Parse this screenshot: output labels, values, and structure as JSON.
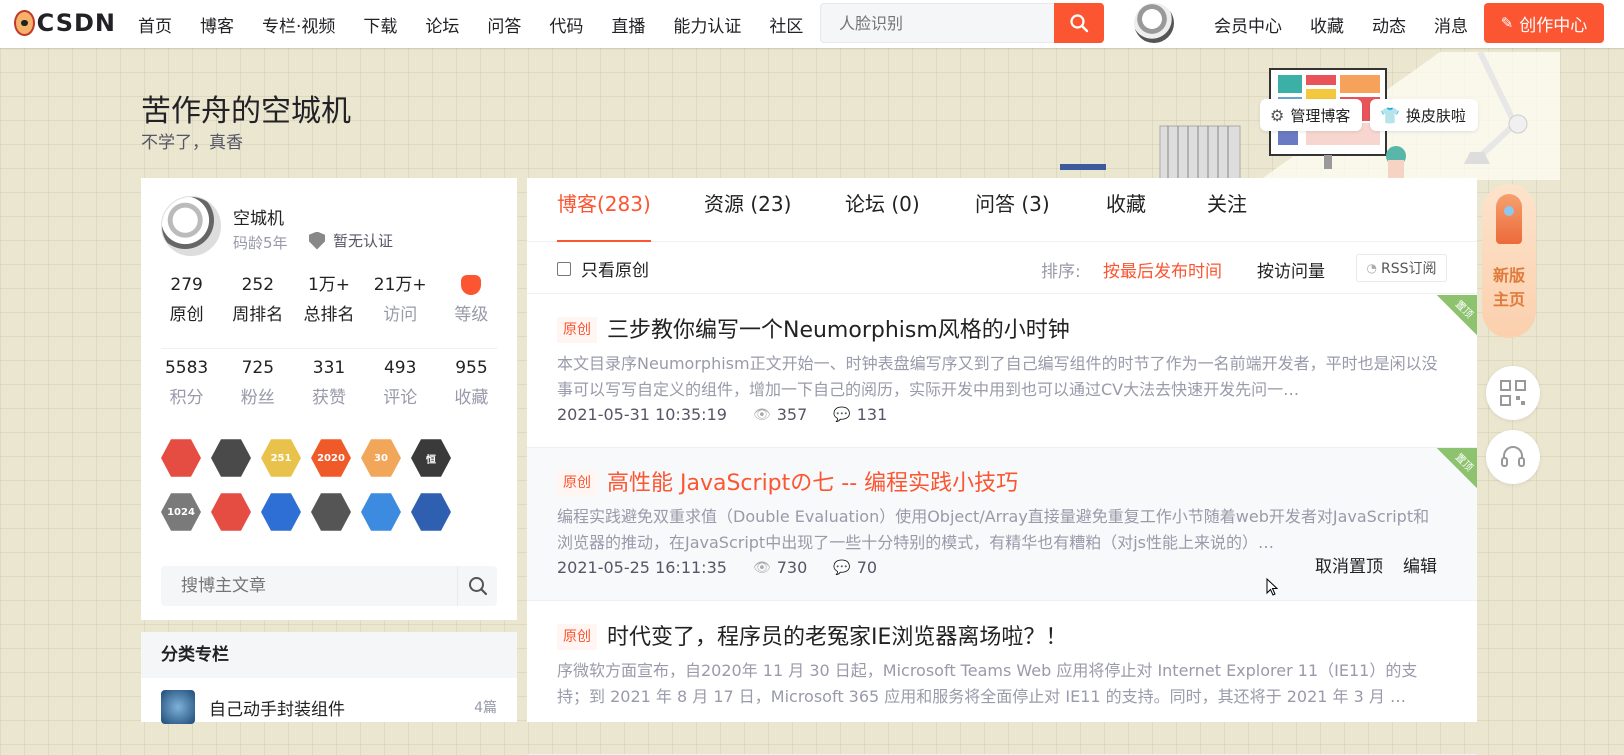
{
  "topbar": {
    "logo_text": "CSDN",
    "nav": [
      "首页",
      "博客",
      "专栏·视频",
      "下载",
      "论坛",
      "问答",
      "代码",
      "直播",
      "能力认证",
      "社区"
    ],
    "search_placeholder": "人脸识别",
    "right_links": [
      "会员中心",
      "收藏",
      "动态",
      "消息"
    ],
    "create_label": "创作中心"
  },
  "header": {
    "title": "苦作舟的空城机",
    "subtitle": "不学了，真香",
    "manage_label": "管理博客",
    "skin_label": "换皮肤啦"
  },
  "profile": {
    "name": "空城机",
    "age": "码龄5年",
    "cert": "暂无认证",
    "stats_row1": [
      {
        "value": "279",
        "label": "原创"
      },
      {
        "value": "252",
        "label": "周排名"
      },
      {
        "value": "1万+",
        "label": "总排名"
      },
      {
        "value": "21万+",
        "label": "访问"
      },
      {
        "value": "",
        "label": "等级"
      }
    ],
    "stats_row2": [
      {
        "value": "5583",
        "label": "积分"
      },
      {
        "value": "725",
        "label": "粉丝"
      },
      {
        "value": "331",
        "label": "获赞"
      },
      {
        "value": "493",
        "label": "评论"
      },
      {
        "value": "955",
        "label": "收藏"
      }
    ],
    "badges": [
      {
        "icon": "monkey-badge-icon",
        "color": "#e54d42",
        "text": ""
      },
      {
        "icon": "github-badge-icon",
        "color": "#4a4a4a",
        "text": ""
      },
      {
        "icon": "251-badge-icon",
        "color": "#e8c24a",
        "text": "251"
      },
      {
        "icon": "2020-badge-icon",
        "color": "#f05a28",
        "text": "2020"
      },
      {
        "icon": "30-badge-icon",
        "color": "#f2a65a",
        "text": "30"
      },
      {
        "icon": "heng-badge-icon",
        "color": "#3a3a3a",
        "text": "恒"
      },
      {
        "icon": "1024-badge-icon",
        "color": "#7a7a7a",
        "text": "1024"
      },
      {
        "icon": "pen-badge-icon",
        "color": "#e54d42",
        "text": ""
      },
      {
        "icon": "flag-badge-icon",
        "color": "#2e6fd6",
        "text": ""
      },
      {
        "icon": "medal-badge-icon",
        "color": "#555555",
        "text": ""
      },
      {
        "icon": "astronaut-badge-icon",
        "color": "#3d8be0",
        "text": ""
      },
      {
        "icon": "rocket-badge-icon",
        "color": "#2f5fb0",
        "text": ""
      }
    ]
  },
  "sidebar_search": {
    "placeholder": "搜博主文章"
  },
  "category": {
    "heading": "分类专栏",
    "items": [
      {
        "name": "自己动手封装组件",
        "count": "4篇"
      }
    ]
  },
  "tabs": [
    "博客(283)",
    "资源 (23)",
    "论坛 (0)",
    "问答 (3)",
    "收藏",
    "关注"
  ],
  "filter": {
    "original_only": "只看原创",
    "sort_label": "排序:",
    "sort_latest": "按最后发布时间",
    "sort_views": "按访问量",
    "rss": "RSS订阅"
  },
  "articles": [
    {
      "tag": "原创",
      "title": "三步教你编写一个Neumorphism风格的小时钟",
      "desc": "本文目录序Neumorphism正文开始一、时钟表盘编写序又到了自己编写组件的时节了作为一名前端开发者，平时也是闲以没事可以写写自定义的组件，增加一下自己的阅历，实际开发中用到也可以通过CV大法去快速开发先问一…",
      "date": "2021-05-31 10:35:19",
      "views": "357",
      "comments": "131",
      "pin": "置顶"
    },
    {
      "tag": "原创",
      "title": "高性能 JavaScriptの七 -- 编程实践小技巧",
      "desc": "编程实践避免双重求值（Double Evaluation）使用Object/Array直接量避免重复工作小节随着web开发者对JavaScript和浏览器的推动，在JavaScript中出现了一些十分特别的模式，有精华也有糟粕（对js性能上来说的）…",
      "date": "2021-05-25 16:11:35",
      "views": "730",
      "comments": "70",
      "pin": "置顶",
      "action_unpin": "取消置顶",
      "action_edit": "编辑"
    },
    {
      "tag": "原创",
      "title": "时代变了，程序员的老冤家IE浏览器离场啦？！",
      "desc": "序微软方面宣布，自2020年 11 月 30 日起，Microsoft Teams Web 应用将停止对 Internet Explorer 11（IE11）的支持；到 2021 年 8 月 17 日，Microsoft 365 应用和服务将全面停止对 IE11 的支持。同时，其还将于 2021 年 3 月 …",
      "date": "",
      "views": "",
      "comments": ""
    }
  ],
  "floating": {
    "new_home": "新版主页"
  },
  "colors": {
    "accent": "#fc5531",
    "pin": "#8dc26f"
  }
}
